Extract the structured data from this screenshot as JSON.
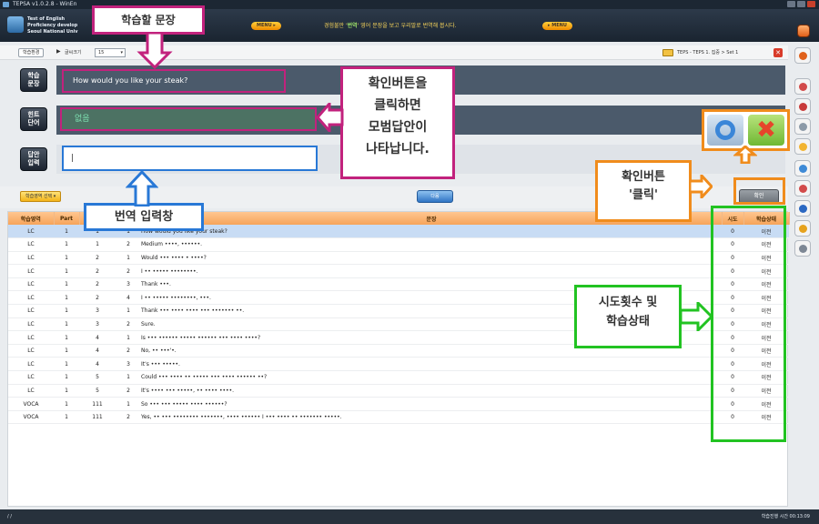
{
  "window": {
    "title": "TEPSA v1.0.2.8 - WinEn"
  },
  "header": {
    "logo_lines": [
      "Test of English",
      "Proficiency develop",
      "Seoul National Univ"
    ],
    "menu_left": "MENU ▸",
    "menu_right": "▸ MENU",
    "notice_prefix": "경험불만 '",
    "notice_mid": "번역",
    "notice_suffix": "' 영어 문장을 보고 우리말로 번역해 봅시다."
  },
  "nav": {
    "mode_label": "학습환경",
    "arrow": "▶",
    "font_label": "글씨크기",
    "font_size": "15",
    "breadcrumb": "TEPS - TEPS 1. 집중 > Set 1"
  },
  "labels": {
    "sentence": [
      "학습",
      "문장"
    ],
    "hint": [
      "힌트",
      "단어"
    ],
    "answer": [
      "답안",
      "입력"
    ]
  },
  "sentence": "How would you like your steak?",
  "hint": "없음",
  "answer": {
    "value": "|",
    "placeholder": ""
  },
  "controls": {
    "area_select": "학습영역 선택 ▾",
    "next": "다음",
    "confirm": "확인"
  },
  "table": {
    "headers": [
      "학습영역",
      "Part",
      "",
      "",
      "문장",
      "시도",
      "학습상태"
    ],
    "rows": [
      [
        "LC",
        "1",
        "1",
        "1",
        "How would you like your steak?",
        "0",
        "이전"
      ],
      [
        "LC",
        "1",
        "1",
        "2",
        "Medium ••••, ••••••.",
        "0",
        "이전"
      ],
      [
        "LC",
        "1",
        "2",
        "1",
        "Would ••• •••• • ••••?",
        "0",
        "이전"
      ],
      [
        "LC",
        "1",
        "2",
        "2",
        "I •• ••••• ••••••••.",
        "0",
        "이전"
      ],
      [
        "LC",
        "1",
        "2",
        "3",
        "Thank •••.",
        "0",
        "이전"
      ],
      [
        "LC",
        "1",
        "2",
        "4",
        "I •• ••••• ••••••••, •••.",
        "0",
        "이전"
      ],
      [
        "LC",
        "1",
        "3",
        "1",
        "Thank ••• •••• •••• ••• ••••••• ••.",
        "0",
        "이전"
      ],
      [
        "LC",
        "1",
        "3",
        "2",
        "Sure.",
        "0",
        "이전"
      ],
      [
        "LC",
        "1",
        "4",
        "1",
        "Is ••• •••••• ••••• •••••• ••• •••• ••••?",
        "0",
        "이전"
      ],
      [
        "LC",
        "1",
        "4",
        "2",
        "No, •• •••'•.",
        "0",
        "이전"
      ],
      [
        "LC",
        "1",
        "4",
        "3",
        "It's ••• •••••.",
        "0",
        "이전"
      ],
      [
        "LC",
        "1",
        "5",
        "1",
        "Could ••• •••• •• ••••• ••• •••• •••••• ••?",
        "0",
        "이전"
      ],
      [
        "LC",
        "1",
        "5",
        "2",
        "It's •••• ••• •••••, •• •••• ••••.",
        "0",
        "이전"
      ],
      [
        "VOCA",
        "1",
        "111",
        "1",
        "So ••• ••• ••••• •••• ••••••?",
        "0",
        "이전"
      ],
      [
        "VOCA",
        "1",
        "111",
        "2",
        "Yes, •• ••• •••••••• •••••••, •••• •••••• I ••• •••• •• ••••••• •••••.",
        "0",
        "이전"
      ]
    ]
  },
  "status": {
    "left": "/ /",
    "right": "학습진행 시간 00:13:09"
  },
  "callouts": {
    "sentence": "학습할 문장",
    "confirm_answer": [
      "확인버튼을",
      "클릭하면",
      "모범답안이",
      "나타납니다."
    ],
    "input": "번역 입력창",
    "click": [
      "확인버튼",
      "'클릭'"
    ],
    "attempts": [
      "시도횟수 및",
      "학습상태"
    ]
  },
  "colors": {
    "magenta": "#c2227d",
    "blue": "#2878d6",
    "orange": "#f08c1c",
    "green": "#22c322"
  }
}
